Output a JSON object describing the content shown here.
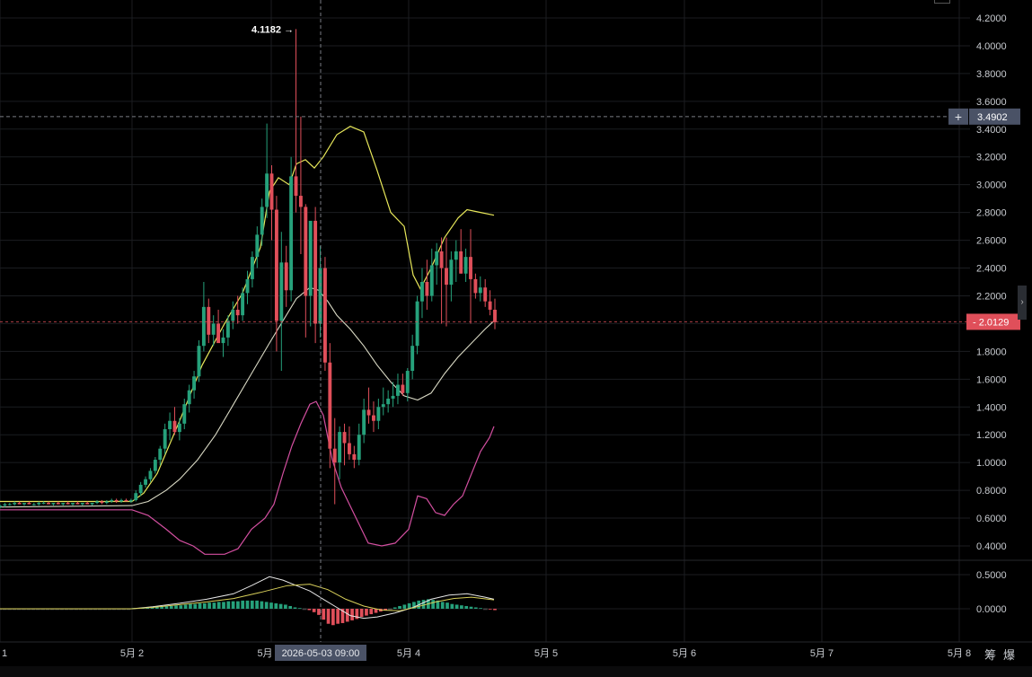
{
  "chart_data": {
    "type": "candlestick",
    "indicators": [
      "Bollinger Bands (upper/middle/lower)",
      "MACD"
    ],
    "x_labels": [
      "1",
      "5月 2",
      "5月",
      "5月 4",
      "5月 5",
      "5月 6",
      "5月 7",
      "5月 8"
    ],
    "crosshair_time_label": "2026-05-03 09:00",
    "main_y_ticks": [
      "4.2000",
      "4.0000",
      "3.8000",
      "3.6000",
      "3.4000",
      "3.2000",
      "3.0000",
      "2.8000",
      "2.6000",
      "2.4000",
      "2.2000",
      "2.0000",
      "1.8000",
      "1.6000",
      "1.4000",
      "1.2000",
      "1.0000",
      "0.8000",
      "0.6000",
      "0.4000"
    ],
    "main_ylim": [
      0.3,
      4.3
    ],
    "macd_y_ticks": [
      "0.5000",
      "0.0000"
    ],
    "macd_ylim": [
      -0.25,
      0.55
    ],
    "max_price_label": "4.1182",
    "crosshair_price_label": "3.4902",
    "current_price_label": "2.0129",
    "candles": [
      [
        0.68,
        0.7,
        0.67,
        0.69
      ],
      [
        0.69,
        0.71,
        0.68,
        0.7
      ],
      [
        0.7,
        0.71,
        0.69,
        0.7
      ],
      [
        0.7,
        0.72,
        0.69,
        0.71
      ],
      [
        0.71,
        0.72,
        0.7,
        0.7
      ],
      [
        0.7,
        0.71,
        0.69,
        0.71
      ],
      [
        0.71,
        0.72,
        0.7,
        0.7
      ],
      [
        0.7,
        0.71,
        0.69,
        0.7
      ],
      [
        0.7,
        0.72,
        0.69,
        0.71
      ],
      [
        0.71,
        0.72,
        0.7,
        0.71
      ],
      [
        0.71,
        0.72,
        0.7,
        0.7
      ],
      [
        0.7,
        0.71,
        0.69,
        0.71
      ],
      [
        0.71,
        0.72,
        0.7,
        0.7
      ],
      [
        0.7,
        0.71,
        0.69,
        0.71
      ],
      [
        0.71,
        0.72,
        0.7,
        0.7
      ],
      [
        0.7,
        0.71,
        0.69,
        0.71
      ],
      [
        0.71,
        0.72,
        0.7,
        0.7
      ],
      [
        0.7,
        0.71,
        0.69,
        0.71
      ],
      [
        0.71,
        0.72,
        0.7,
        0.7
      ],
      [
        0.7,
        0.71,
        0.69,
        0.71
      ],
      [
        0.71,
        0.73,
        0.7,
        0.72
      ],
      [
        0.72,
        0.73,
        0.7,
        0.71
      ],
      [
        0.71,
        0.73,
        0.7,
        0.72
      ],
      [
        0.72,
        0.74,
        0.71,
        0.73
      ],
      [
        0.73,
        0.74,
        0.71,
        0.72
      ],
      [
        0.72,
        0.74,
        0.71,
        0.73
      ],
      [
        0.73,
        0.74,
        0.72,
        0.72
      ],
      [
        0.72,
        0.74,
        0.71,
        0.73
      ],
      [
        0.73,
        0.8,
        0.72,
        0.78
      ],
      [
        0.78,
        0.86,
        0.76,
        0.84
      ],
      [
        0.84,
        0.9,
        0.82,
        0.88
      ],
      [
        0.88,
        0.96,
        0.86,
        0.94
      ],
      [
        0.94,
        1.04,
        0.92,
        1.02
      ],
      [
        1.02,
        1.12,
        0.98,
        1.1
      ],
      [
        1.1,
        1.28,
        1.06,
        1.24
      ],
      [
        1.24,
        1.36,
        1.16,
        1.3
      ],
      [
        1.3,
        1.4,
        1.2,
        1.22
      ],
      [
        1.22,
        1.32,
        1.16,
        1.28
      ],
      [
        1.28,
        1.46,
        1.24,
        1.42
      ],
      [
        1.42,
        1.56,
        1.36,
        1.52
      ],
      [
        1.52,
        1.66,
        1.46,
        1.62
      ],
      [
        1.62,
        1.88,
        1.58,
        1.84
      ],
      [
        1.84,
        2.3,
        1.8,
        2.12
      ],
      [
        2.12,
        2.18,
        1.86,
        1.92
      ],
      [
        1.92,
        2.06,
        1.84,
        2.0
      ],
      [
        2.0,
        2.1,
        1.9,
        1.86
      ],
      [
        1.86,
        1.96,
        1.76,
        1.9
      ],
      [
        1.9,
        2.06,
        1.84,
        2.02
      ],
      [
        2.02,
        2.16,
        1.96,
        2.1
      ],
      [
        2.1,
        2.2,
        2.0,
        2.06
      ],
      [
        2.06,
        2.26,
        2.02,
        2.22
      ],
      [
        2.22,
        2.38,
        2.14,
        2.32
      ],
      [
        2.32,
        2.52,
        2.26,
        2.48
      ],
      [
        2.48,
        2.7,
        2.4,
        2.64
      ],
      [
        2.64,
        2.9,
        2.56,
        2.84
      ],
      [
        2.84,
        3.44,
        2.76,
        3.08
      ],
      [
        3.08,
        3.14,
        2.6,
        2.82
      ],
      [
        2.82,
        2.92,
        1.8,
        2.02
      ],
      [
        2.02,
        2.66,
        1.66,
        2.44
      ],
      [
        2.44,
        2.56,
        2.12,
        2.24
      ],
      [
        2.24,
        3.2,
        2.16,
        3.06
      ],
      [
        3.06,
        4.12,
        2.8,
        2.92
      ],
      [
        2.92,
        3.49,
        2.5,
        2.84
      ],
      [
        2.84,
        2.86,
        1.9,
        2.2
      ],
      [
        2.2,
        2.56,
        1.98,
        2.74
      ],
      [
        2.74,
        2.84,
        1.86,
        2.0
      ],
      [
        2.0,
        2.56,
        1.9,
        2.4
      ],
      [
        2.4,
        2.48,
        1.66,
        1.72
      ],
      [
        1.72,
        1.86,
        0.96,
        1.1
      ],
      [
        1.1,
        1.32,
        0.7,
        1.0
      ],
      [
        1.0,
        1.26,
        0.88,
        1.22
      ],
      [
        1.22,
        1.28,
        0.98,
        1.14
      ],
      [
        1.14,
        1.26,
        1.02,
        1.06
      ],
      [
        1.06,
        1.12,
        0.96,
        1.02
      ],
      [
        1.02,
        1.28,
        0.98,
        1.2
      ],
      [
        1.2,
        1.46,
        1.14,
        1.38
      ],
      [
        1.38,
        1.54,
        1.28,
        1.34
      ],
      [
        1.34,
        1.44,
        1.22,
        1.3
      ],
      [
        1.3,
        1.46,
        1.24,
        1.4
      ],
      [
        1.4,
        1.54,
        1.34,
        1.42
      ],
      [
        1.42,
        1.52,
        1.36,
        1.46
      ],
      [
        1.46,
        1.58,
        1.4,
        1.48
      ],
      [
        1.48,
        1.64,
        1.42,
        1.56
      ],
      [
        1.56,
        1.64,
        1.48,
        1.5
      ],
      [
        1.5,
        1.68,
        1.44,
        1.66
      ],
      [
        1.66,
        1.92,
        1.6,
        1.84
      ],
      [
        1.84,
        2.2,
        1.78,
        2.16
      ],
      [
        2.16,
        2.4,
        2.04,
        2.3
      ],
      [
        2.3,
        2.46,
        2.1,
        2.2
      ],
      [
        2.2,
        2.54,
        2.16,
        2.42
      ],
      [
        2.42,
        2.58,
        2.28,
        2.52
      ],
      [
        2.52,
        2.62,
        2.0,
        2.4
      ],
      [
        2.4,
        2.62,
        1.98,
        2.28
      ],
      [
        2.28,
        2.52,
        2.16,
        2.46
      ],
      [
        2.46,
        2.6,
        2.3,
        2.52
      ],
      [
        2.52,
        2.68,
        2.36,
        2.36
      ],
      [
        2.36,
        2.54,
        2.3,
        2.48
      ],
      [
        2.48,
        2.68,
        2.0,
        2.32
      ],
      [
        2.32,
        2.36,
        2.18,
        2.22
      ],
      [
        2.22,
        2.34,
        2.16,
        2.26
      ],
      [
        2.26,
        2.32,
        2.12,
        2.16
      ],
      [
        2.16,
        2.24,
        2.06,
        2.1
      ],
      [
        2.1,
        2.18,
        1.96,
        2.01
      ]
    ],
    "bollinger_upper": [
      [
        0,
        0.72
      ],
      [
        147,
        0.72
      ],
      [
        160,
        0.78
      ],
      [
        175,
        0.92
      ],
      [
        200,
        1.3
      ],
      [
        225,
        1.7
      ],
      [
        250,
        2.0
      ],
      [
        270,
        2.22
      ],
      [
        290,
        2.55
      ],
      [
        300,
        2.95
      ],
      [
        310,
        3.05
      ],
      [
        322,
        3.0
      ],
      [
        330,
        3.15
      ],
      [
        340,
        3.18
      ],
      [
        350,
        3.12
      ],
      [
        360,
        3.2
      ],
      [
        375,
        3.36
      ],
      [
        390,
        3.42
      ],
      [
        405,
        3.38
      ],
      [
        420,
        3.1
      ],
      [
        435,
        2.8
      ],
      [
        450,
        2.7
      ],
      [
        460,
        2.35
      ],
      [
        468,
        2.25
      ],
      [
        480,
        2.4
      ],
      [
        495,
        2.62
      ],
      [
        510,
        2.76
      ],
      [
        520,
        2.82
      ],
      [
        535,
        2.8
      ],
      [
        550,
        2.78
      ]
    ],
    "bollinger_middle": [
      [
        0,
        0.68
      ],
      [
        147,
        0.69
      ],
      [
        165,
        0.72
      ],
      [
        185,
        0.8
      ],
      [
        200,
        0.88
      ],
      [
        220,
        1.02
      ],
      [
        240,
        1.2
      ],
      [
        260,
        1.42
      ],
      [
        280,
        1.64
      ],
      [
        300,
        1.86
      ],
      [
        315,
        2.02
      ],
      [
        330,
        2.18
      ],
      [
        345,
        2.26
      ],
      [
        355,
        2.24
      ],
      [
        365,
        2.16
      ],
      [
        375,
        2.06
      ],
      [
        390,
        1.96
      ],
      [
        405,
        1.84
      ],
      [
        420,
        1.7
      ],
      [
        435,
        1.58
      ],
      [
        450,
        1.48
      ],
      [
        465,
        1.45
      ],
      [
        480,
        1.5
      ],
      [
        495,
        1.64
      ],
      [
        510,
        1.76
      ],
      [
        525,
        1.86
      ],
      [
        540,
        1.96
      ],
      [
        550,
        2.02
      ]
    ],
    "bollinger_lower": [
      [
        0,
        0.66
      ],
      [
        147,
        0.66
      ],
      [
        165,
        0.62
      ],
      [
        185,
        0.52
      ],
      [
        200,
        0.44
      ],
      [
        215,
        0.4
      ],
      [
        228,
        0.34
      ],
      [
        250,
        0.34
      ],
      [
        265,
        0.38
      ],
      [
        280,
        0.52
      ],
      [
        295,
        0.6
      ],
      [
        305,
        0.7
      ],
      [
        315,
        0.92
      ],
      [
        325,
        1.12
      ],
      [
        335,
        1.28
      ],
      [
        345,
        1.42
      ],
      [
        352,
        1.44
      ],
      [
        360,
        1.34
      ],
      [
        370,
        1.02
      ],
      [
        380,
        0.82
      ],
      [
        395,
        0.62
      ],
      [
        410,
        0.42
      ],
      [
        425,
        0.4
      ],
      [
        440,
        0.42
      ],
      [
        455,
        0.52
      ],
      [
        465,
        0.76
      ],
      [
        475,
        0.74
      ],
      [
        485,
        0.64
      ],
      [
        495,
        0.62
      ],
      [
        505,
        0.7
      ],
      [
        515,
        0.76
      ],
      [
        525,
        0.92
      ],
      [
        535,
        1.08
      ],
      [
        545,
        1.18
      ],
      [
        550,
        1.26
      ]
    ],
    "macd_line_white": [
      [
        0,
        0.0
      ],
      [
        147,
        0.0
      ],
      [
        170,
        0.03
      ],
      [
        200,
        0.08
      ],
      [
        230,
        0.14
      ],
      [
        260,
        0.22
      ],
      [
        280,
        0.34
      ],
      [
        300,
        0.47
      ],
      [
        315,
        0.42
      ],
      [
        330,
        0.34
      ],
      [
        345,
        0.26
      ],
      [
        360,
        0.14
      ],
      [
        375,
        0.02
      ],
      [
        390,
        -0.1
      ],
      [
        405,
        -0.14
      ],
      [
        420,
        -0.12
      ],
      [
        440,
        -0.06
      ],
      [
        460,
        0.02
      ],
      [
        480,
        0.14
      ],
      [
        500,
        0.2
      ],
      [
        520,
        0.22
      ],
      [
        540,
        0.17
      ],
      [
        550,
        0.14
      ]
    ],
    "macd_line_yellow": [
      [
        0,
        0.0
      ],
      [
        147,
        0.0
      ],
      [
        170,
        0.02
      ],
      [
        200,
        0.06
      ],
      [
        230,
        0.1
      ],
      [
        260,
        0.15
      ],
      [
        290,
        0.24
      ],
      [
        320,
        0.34
      ],
      [
        345,
        0.36
      ],
      [
        365,
        0.28
      ],
      [
        385,
        0.14
      ],
      [
        405,
        0.04
      ],
      [
        425,
        -0.02
      ],
      [
        445,
        -0.03
      ],
      [
        465,
        0.03
      ],
      [
        485,
        0.1
      ],
      [
        505,
        0.15
      ],
      [
        525,
        0.17
      ],
      [
        550,
        0.13
      ]
    ],
    "macd_hist": [
      0.0,
      0.0,
      0.0,
      0.0,
      0.0,
      0.0,
      0.0,
      0.0,
      0.0,
      0.0,
      0.0,
      0.0,
      0.0,
      0.0,
      0.0,
      0.0,
      0.0,
      0.0,
      0.0,
      0.0,
      0.0,
      0.0,
      0.0,
      0.0,
      0.0,
      0.0,
      0.0,
      0.0,
      0.01,
      0.01,
      0.02,
      0.02,
      0.02,
      0.03,
      0.03,
      0.04,
      0.04,
      0.05,
      0.05,
      0.06,
      0.07,
      0.07,
      0.08,
      0.08,
      0.09,
      0.09,
      0.1,
      0.1,
      0.11,
      0.11,
      0.11,
      0.12,
      0.12,
      0.12,
      0.12,
      0.11,
      0.1,
      0.09,
      0.08,
      0.07,
      0.06,
      0.04,
      0.02,
      0.01,
      0.0,
      -0.02,
      -0.05,
      -0.09,
      -0.16,
      -0.22,
      -0.24,
      -0.22,
      -0.21,
      -0.19,
      -0.17,
      -0.15,
      -0.12,
      -0.1,
      -0.08,
      -0.06,
      -0.04,
      -0.02,
      0.0,
      0.02,
      0.04,
      0.06,
      0.08,
      0.1,
      0.12,
      0.13,
      0.14,
      0.13,
      0.12,
      0.1,
      0.09,
      0.07,
      0.06,
      0.05,
      0.04,
      0.03,
      0.02,
      0.01,
      0.0,
      -0.01,
      -0.02
    ],
    "colors": {
      "up": "#26a17b",
      "down": "#e04f5a",
      "bollinger_upper": "#e8e85a",
      "bollinger_middle": "#d9d9c4",
      "bollinger_lower": "#d34fa0",
      "macd_white": "#e6e6e6",
      "macd_yellow": "#d9d05a",
      "grid": "#1b1d21",
      "crosshair": "#7a7d84",
      "current_price_tag": "#e04f5a",
      "crosshair_tag": "#4a5266",
      "axis_text": "#c9ccd1"
    }
  },
  "axis_bottom_right_labels": [
    "筹",
    "爆"
  ],
  "bottom_tabs_hint": ""
}
